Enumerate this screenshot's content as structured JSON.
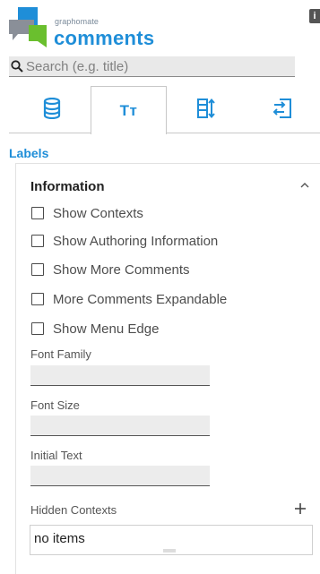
{
  "header": {
    "brand_small": "graphomate",
    "brand_name": "comments",
    "corner_badge": "i",
    "brand_colors": {
      "blue": "#1f8ed8",
      "green": "#6abf2e",
      "gray": "#8a8f98"
    }
  },
  "search": {
    "placeholder": "Search (e.g. title)",
    "value": ""
  },
  "tabs": [
    {
      "name": "data",
      "icon": "database-icon",
      "active": false
    },
    {
      "name": "labels",
      "icon": "text-format-icon",
      "label": "Tт",
      "active": true
    },
    {
      "name": "layout",
      "icon": "columns-sort-icon",
      "active": false
    },
    {
      "name": "export",
      "icon": "import-export-icon",
      "active": false
    }
  ],
  "section": {
    "title": "Labels"
  },
  "panel": {
    "title": "Information",
    "checkboxes": [
      {
        "label": "Show Contexts",
        "checked": false
      },
      {
        "label": "Show Authoring Information",
        "checked": false
      },
      {
        "label": "Show More Comments",
        "checked": false
      },
      {
        "label": "More Comments Expandable",
        "checked": false
      },
      {
        "label": "Show Menu Edge",
        "checked": false
      }
    ],
    "fields": [
      {
        "label": "Font Family",
        "value": ""
      },
      {
        "label": "Font Size",
        "value": ""
      },
      {
        "label": "Initial Text",
        "value": ""
      }
    ],
    "hidden_contexts": {
      "label": "Hidden Contexts",
      "empty_text": "no items"
    }
  },
  "colors": {
    "accent": "#1f8ed8"
  }
}
